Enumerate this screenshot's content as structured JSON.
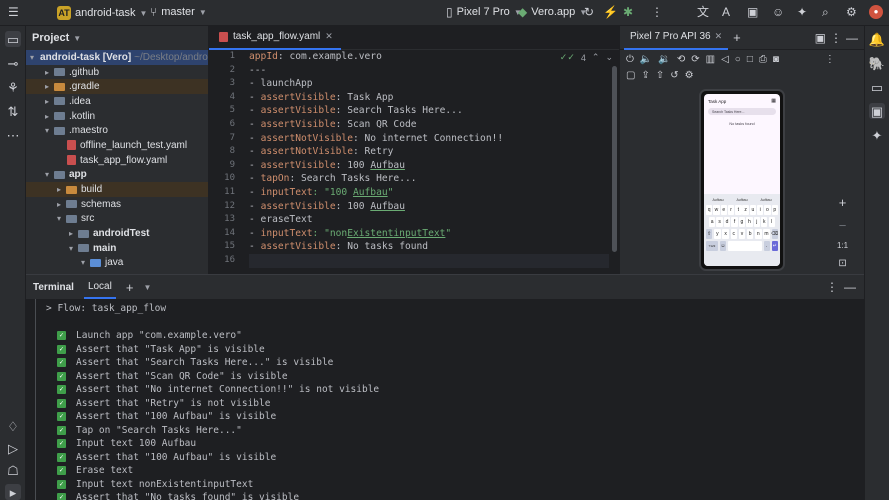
{
  "titlebar": {
    "project_badge": "AT",
    "project_name": "android-task",
    "branch": "master",
    "device": "Pixel 7 Pro",
    "run_config": "Vero.app"
  },
  "project_panel": {
    "title": "Project",
    "rows": [
      {
        "label": "android-task [Vero]",
        "suffix": "~/Desktop/android-task",
        "type": "folder",
        "indent": 0,
        "arrow": "▾"
      },
      {
        "label": ".github",
        "type": "folder",
        "indent": 1,
        "arrow": "▸"
      },
      {
        "label": ".gradle",
        "type": "folder-orange",
        "indent": 1,
        "arrow": "▸"
      },
      {
        "label": ".idea",
        "type": "folder",
        "indent": 1,
        "arrow": "▸"
      },
      {
        "label": ".kotlin",
        "type": "folder",
        "indent": 1,
        "arrow": "▸"
      },
      {
        "label": ".maestro",
        "type": "folder",
        "indent": 1,
        "arrow": "▾"
      },
      {
        "label": "offline_launch_test.yaml",
        "type": "file",
        "indent": 2,
        "arrow": ""
      },
      {
        "label": "task_app_flow.yaml",
        "type": "file",
        "indent": 2,
        "arrow": ""
      },
      {
        "label": "app",
        "type": "folder",
        "indent": 1,
        "arrow": "▾"
      },
      {
        "label": "build",
        "type": "folder-orange",
        "indent": 2,
        "arrow": "▸"
      },
      {
        "label": "schemas",
        "type": "folder",
        "indent": 2,
        "arrow": "▸"
      },
      {
        "label": "src",
        "type": "folder",
        "indent": 2,
        "arrow": "▾"
      },
      {
        "label": "androidTest",
        "type": "folder",
        "indent": 3,
        "arrow": "▸"
      },
      {
        "label": "main",
        "type": "folder",
        "indent": 3,
        "arrow": "▾"
      },
      {
        "label": "java",
        "type": "folder-blue",
        "indent": 4,
        "arrow": "▾"
      }
    ]
  },
  "editor": {
    "tab_label": "task_app_flow.yaml",
    "inspection_count": "4",
    "lines": [
      [
        {
          "t": "appId",
          "c": "k"
        },
        {
          "t": ": com.example.vero",
          "c": ""
        }
      ],
      [
        {
          "t": "---",
          "c": ""
        }
      ],
      [
        {
          "t": "- launchApp",
          "c": ""
        }
      ],
      [
        {
          "t": "- ",
          "c": ""
        },
        {
          "t": "assertVisible",
          "c": "k"
        },
        {
          "t": ": Task App",
          "c": ""
        }
      ],
      [
        {
          "t": "- ",
          "c": ""
        },
        {
          "t": "assertVisible",
          "c": "k"
        },
        {
          "t": ": Search Tasks Here...",
          "c": ""
        }
      ],
      [
        {
          "t": "- ",
          "c": ""
        },
        {
          "t": "assertVisible",
          "c": "k"
        },
        {
          "t": ": Scan QR Code",
          "c": ""
        }
      ],
      [
        {
          "t": "- ",
          "c": ""
        },
        {
          "t": "assertNotVisible",
          "c": "k"
        },
        {
          "t": ": No internet Connection!!",
          "c": ""
        }
      ],
      [
        {
          "t": "- ",
          "c": ""
        },
        {
          "t": "assertNotVisible",
          "c": "k"
        },
        {
          "t": ": Retry",
          "c": ""
        }
      ],
      [
        {
          "t": "- ",
          "c": ""
        },
        {
          "t": "assertVisible",
          "c": "k"
        },
        {
          "t": ": 100 ",
          "c": ""
        },
        {
          "t": "Aufbau",
          "c": "u"
        }
      ],
      [
        {
          "t": "- ",
          "c": ""
        },
        {
          "t": "tapOn",
          "c": "k"
        },
        {
          "t": ": Search Tasks Here...",
          "c": ""
        }
      ],
      [
        {
          "t": "- ",
          "c": ""
        },
        {
          "t": "inputText",
          "c": "k"
        },
        {
          "t": ": \"100 ",
          "c": "s"
        },
        {
          "t": "Aufbau",
          "c": "s u"
        },
        {
          "t": "\"",
          "c": "s"
        }
      ],
      [
        {
          "t": "- ",
          "c": ""
        },
        {
          "t": "assertVisible",
          "c": "k"
        },
        {
          "t": ": 100 ",
          "c": ""
        },
        {
          "t": "Aufbau",
          "c": "u"
        }
      ],
      [
        {
          "t": "- eraseText",
          "c": ""
        }
      ],
      [
        {
          "t": "- ",
          "c": ""
        },
        {
          "t": "inputText",
          "c": "k"
        },
        {
          "t": ": \"non",
          "c": "s"
        },
        {
          "t": "ExistentinputText",
          "c": "s u"
        },
        {
          "t": "\"",
          "c": "s"
        }
      ],
      [
        {
          "t": "- ",
          "c": ""
        },
        {
          "t": "assertVisible",
          "c": "k"
        },
        {
          "t": ": No tasks found",
          "c": ""
        }
      ],
      [
        {
          "t": "",
          "c": ""
        }
      ]
    ]
  },
  "emulator": {
    "tab_label": "Pixel 7 Pro API 36",
    "phone_title": "Task App",
    "phone_search": "Search Tasks Here...",
    "phone_empty": "No tasks found",
    "suggestions": [
      "Aufbau",
      "Aufbau",
      "Aufbau"
    ],
    "keyboard_rows": [
      [
        "q",
        "w",
        "e",
        "r",
        "t",
        "z",
        "u",
        "i",
        "o",
        "p"
      ],
      [
        "a",
        "s",
        "d",
        "f",
        "g",
        "h",
        "j",
        "k",
        "l"
      ],
      [
        "⇧",
        "y",
        "x",
        "c",
        "v",
        "b",
        "n",
        "m",
        "⌫"
      ]
    ],
    "zoom_label": "1:1"
  },
  "terminal": {
    "tab_terminal": "Terminal",
    "tab_local": "Local",
    "flow_line": "> Flow: task_app_flow",
    "steps": [
      "Launch app \"com.example.vero\"",
      "Assert that \"Task App\" is visible",
      "Assert that \"Search Tasks Here...\" is visible",
      "Assert that \"Scan QR Code\" is visible",
      "Assert that \"No internet Connection!!\" is not visible",
      "Assert that \"Retry\" is not visible",
      "Assert that \"100 Aufbau\" is visible",
      "Tap on \"Search Tasks Here...\"",
      "Input text 100 Aufbau",
      "Assert that \"100 Aufbau\" is visible",
      "Erase text",
      "Input text nonExistentinputText",
      "Assert that \"No tasks found\" is visible"
    ]
  }
}
